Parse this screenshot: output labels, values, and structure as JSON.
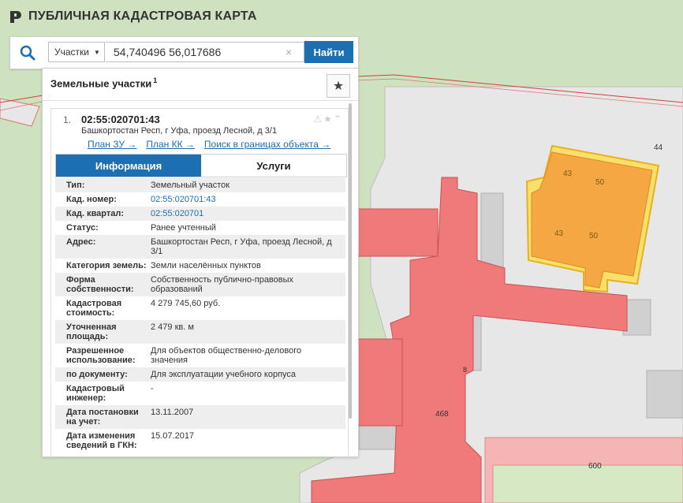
{
  "app": {
    "title": "ПУБЛИЧНАЯ КАДАСТРОВАЯ КАРТА"
  },
  "search": {
    "category": "Участки",
    "query": "54,740496 56,017686",
    "clear_icon": "×",
    "find_label": "Найти"
  },
  "panel": {
    "title": "Земельные участки",
    "count": "1",
    "star_icon": "★"
  },
  "result": {
    "index": "1.",
    "cad_number": "02:55:020701:43",
    "address": "Башкортостан Респ, г Уфа, проезд Лесной, д 3/1",
    "status_icons": "⚠★⌃",
    "links": [
      "План ЗУ →",
      "План КК →",
      "Поиск в границах объекта →"
    ]
  },
  "tabs": {
    "info": "Информация",
    "services": "Услуги"
  },
  "info_rows": [
    {
      "key": "Тип:",
      "value": "Земельный участок"
    },
    {
      "key": "Кад. номер:",
      "value": "02:55:020701:43"
    },
    {
      "key": "Кад. квартал:",
      "value": "02:55:020701"
    },
    {
      "key": "Статус:",
      "value": "Ранее учтенный"
    },
    {
      "key": "Адрес:",
      "value": "Башкортостан Респ, г Уфа, проезд Лесной, д 3/1"
    },
    {
      "key": "Категория земель:",
      "value": "Земли населённых пунктов"
    },
    {
      "key": "Форма собственности:",
      "value": "Собственность публично-правовых образований"
    },
    {
      "key": "Кадастровая стоимость:",
      "value": "4 279 745,60 руб."
    },
    {
      "key": "Уточненная площадь:",
      "value": "2 479 кв. м"
    },
    {
      "key": "Разрешенное использование:",
      "value": "Для объектов общественно-делового значения"
    },
    {
      "key": "по документу:",
      "value": "Для эксплуатации учебного корпуса"
    },
    {
      "key": "Кадастровый инженер:",
      "value": "-"
    },
    {
      "key": "Дата постановки на учет:",
      "value": "13.11.2007"
    },
    {
      "key": "Дата изменения сведений в ГКН:",
      "value": "15.07.2017"
    }
  ],
  "map_labels": {
    "n44": "44",
    "n43a": "43",
    "n50a": "50",
    "n43b": "43",
    "n50b": "50",
    "n468": "468",
    "n600": "600",
    "n8": "8"
  },
  "colors": {
    "accent": "#1c6fb2",
    "map_green": "#cfe2c0",
    "parcel_gray": "#e6e6e6",
    "building_red": "#f07a7a",
    "selected_orange": "#f4a742"
  }
}
